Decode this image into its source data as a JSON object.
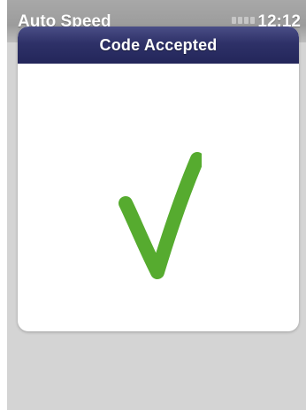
{
  "status_bar": {
    "app_name": "Auto Speed",
    "time": "12:12",
    "signal_icon": "signal-bars-icon"
  },
  "dialog": {
    "title": "Code Accepted",
    "icon": "checkmark-icon",
    "icon_color": "#56ab2f",
    "header_color": "#2e3168"
  },
  "colors": {
    "background": "#d4d4d4",
    "dialog_background": "#ffffff"
  }
}
